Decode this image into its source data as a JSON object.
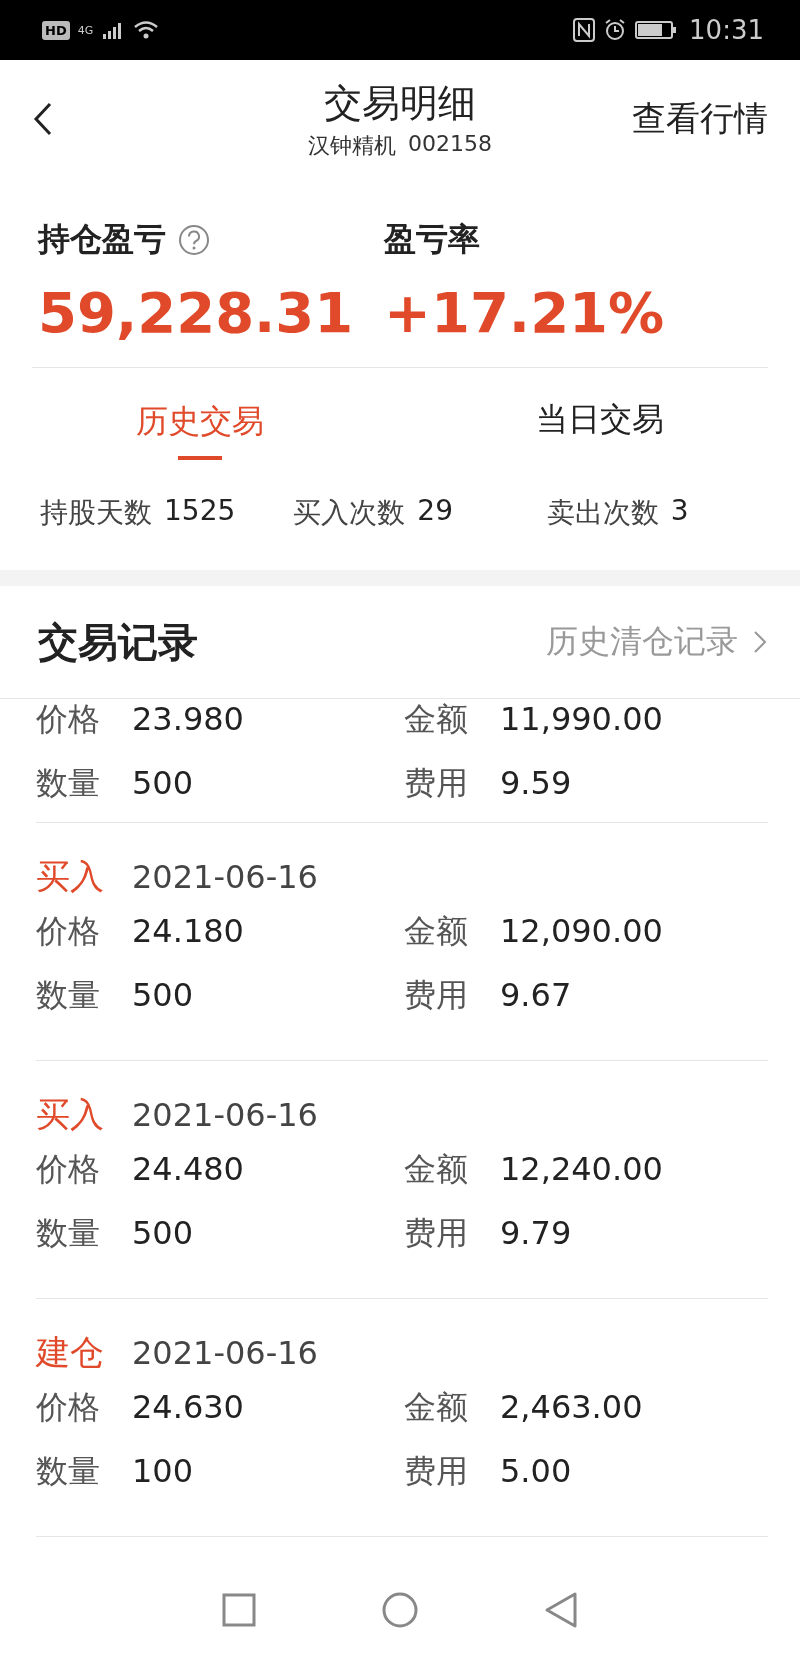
{
  "status_bar": {
    "badge": "HD",
    "time": "10:31",
    "network": "4G"
  },
  "header": {
    "title": "交易明细",
    "stock_name": "汉钟精机",
    "stock_code": "002158",
    "action": "查看行情"
  },
  "summary": [
    {
      "label": "持仓盈亏",
      "has_help": true,
      "value": "59,228.31"
    },
    {
      "label": "盈亏率",
      "has_help": false,
      "value": "+17.21%"
    }
  ],
  "tabs": [
    {
      "label": "历史交易",
      "selected": true
    },
    {
      "label": "当日交易",
      "selected": false
    }
  ],
  "stats": [
    {
      "label": "持股天数",
      "value": "1525"
    },
    {
      "label": "买入次数",
      "value": "29"
    },
    {
      "label": "卖出次数",
      "value": "3"
    }
  ],
  "records_section": {
    "title": "交易记录",
    "link": "历史清仓记录"
  },
  "records": [
    {
      "fields": [
        {
          "label": "价格",
          "value": "23.980"
        },
        {
          "label": "金额",
          "value": "11,990.00"
        },
        {
          "label": "数量",
          "value": "500"
        },
        {
          "label": "费用",
          "value": "9.59"
        }
      ]
    },
    {
      "type": "买入",
      "date": "2021-06-16",
      "fields": [
        {
          "label": "价格",
          "value": "24.180"
        },
        {
          "label": "金额",
          "value": "12,090.00"
        },
        {
          "label": "数量",
          "value": "500"
        },
        {
          "label": "费用",
          "value": "9.67"
        }
      ]
    },
    {
      "type": "买入",
      "date": "2021-06-16",
      "fields": [
        {
          "label": "价格",
          "value": "24.480"
        },
        {
          "label": "金额",
          "value": "12,240.00"
        },
        {
          "label": "数量",
          "value": "500"
        },
        {
          "label": "费用",
          "value": "9.79"
        }
      ]
    },
    {
      "type": "建仓",
      "date": "2021-06-16",
      "fields": [
        {
          "label": "价格",
          "value": "24.630"
        },
        {
          "label": "金额",
          "value": "2,463.00"
        },
        {
          "label": "数量",
          "value": "100"
        },
        {
          "label": "费用",
          "value": "5.00"
        }
      ]
    }
  ]
}
